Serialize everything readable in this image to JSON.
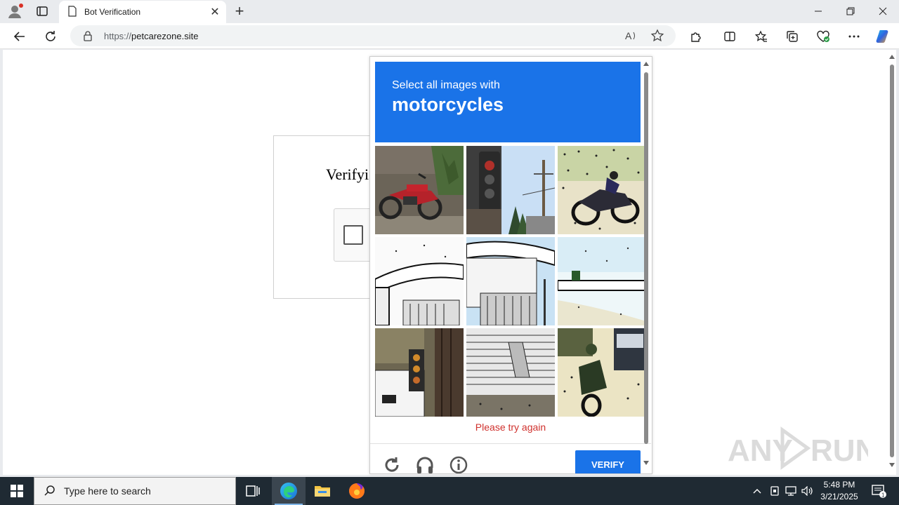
{
  "browser": {
    "tab_title": "Bot Verification",
    "url_prefix": "https://",
    "url_host": "petcarezone.site"
  },
  "page": {
    "heading_partial": "Verifyi"
  },
  "captcha": {
    "instruction": "Select all images with",
    "target": "motorcycles",
    "error": "Please try again",
    "verify_label": "VERIFY",
    "header_color": "#1a73e8",
    "tiles": [
      {
        "name": "tile-motorcycle-red",
        "content": "red motorcycle"
      },
      {
        "name": "tile-traffic-light",
        "content": "traffic light and power pole"
      },
      {
        "name": "tile-motorcycle-dark",
        "content": "motorcycle"
      },
      {
        "name": "tile-bridge-left",
        "content": "overpass"
      },
      {
        "name": "tile-bridge-center",
        "content": "overpass"
      },
      {
        "name": "tile-bridge-right",
        "content": "overpass"
      },
      {
        "name": "tile-traffic-signal",
        "content": "traffic signal"
      },
      {
        "name": "tile-building",
        "content": "building facade"
      },
      {
        "name": "tile-motorcycle-rider",
        "content": "motorcycle with rider"
      }
    ]
  },
  "taskbar": {
    "search_placeholder": "Type here to search",
    "time": "5:48 PM",
    "date": "3/21/2025",
    "notification_count": "1"
  },
  "watermark": {
    "text_left": "ANY",
    "text_right": "RUN"
  }
}
